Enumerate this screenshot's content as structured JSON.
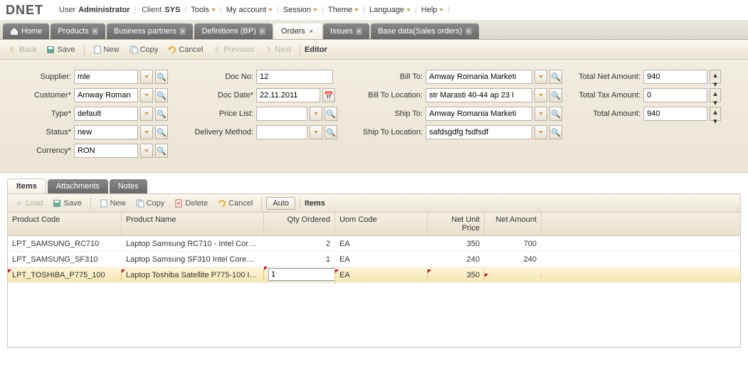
{
  "topmenu": {
    "logo": "DNET",
    "user_lbl": "User",
    "user_val": "Administrator",
    "client_lbl": "Client",
    "client_val": "SYS",
    "items": [
      "Tools",
      "My account",
      "Session",
      "Theme",
      "Language",
      "Help"
    ]
  },
  "tabs": [
    {
      "label": "Home",
      "icon": "home"
    },
    {
      "label": "Products",
      "close": true
    },
    {
      "label": "Business partners",
      "close": true
    },
    {
      "label": "Definitions (BP)",
      "close": true
    },
    {
      "label": "Orders",
      "close": true,
      "active": true
    },
    {
      "label": "Issues",
      "close": true
    },
    {
      "label": "Base data(Sales orders)",
      "close": true
    }
  ],
  "toolbar": {
    "back": "Back",
    "save": "Save",
    "new": "New",
    "copy": "Copy",
    "cancel": "Cancel",
    "prev": "Previous",
    "next": "Next",
    "editor": "Editor"
  },
  "form": {
    "supplier_lbl": "Supplier:",
    "supplier": "mle",
    "customer_lbl": "Customer*",
    "customer": "Amway Roman",
    "type_lbl": "Type*",
    "type": "default",
    "status_lbl": "Status*",
    "status": "new",
    "currency_lbl": "Currency*",
    "currency": "RON",
    "docno_lbl": "Doc No:",
    "docno": "12",
    "docdate_lbl": "Doc Date*",
    "docdate": "22.11.2011",
    "pricelist_lbl": "Price List:",
    "pricelist": "",
    "delivery_lbl": "Delivery Method:",
    "delivery": "",
    "billto_lbl": "Bill To:",
    "billto": "Amway Romania Marketi",
    "billloc_lbl": "Bill To Location:",
    "billloc": "str Marasti 40-44 ap 23 I",
    "shipto_lbl": "Ship To:",
    "shipto": "Amway Romania Marketi",
    "shiploc_lbl": "Ship To Location:",
    "shiploc": "safdsgdfg fsdfsdf",
    "totalnet_lbl": "Total Net Amount:",
    "totalnet": "940",
    "totaltax_lbl": "Total Tax Amount:",
    "totaltax": "0",
    "totalamt_lbl": "Total Amount:",
    "totalamt": "940"
  },
  "subtabs": [
    "Items",
    "Attachments",
    "Notes"
  ],
  "gridtoolbar": {
    "load": "Load",
    "save": "Save",
    "new": "New",
    "copy": "Copy",
    "delete": "Delete",
    "cancel": "Cancel",
    "auto": "Auto",
    "items": "Items"
  },
  "gridcols": [
    "Product Code",
    "Product Name",
    "Qty Ordered",
    "Uom Code",
    "Net Unit Price",
    "Net Amount"
  ],
  "gridrows": [
    {
      "code": "LPT_SAMSUNG_RC710",
      "name": "Laptop Samsung RC710 - Intel CoreT…",
      "qty": "2",
      "uom": "EA",
      "price": "350",
      "amt": "700"
    },
    {
      "code": "LPT_SAMSUNG_SF310",
      "name": "Laptop Samsung SF310 Intel CoreTM…",
      "qty": "1",
      "uom": "EA",
      "price": "240",
      "amt": "240"
    },
    {
      "code": "LPT_TOSHIBA_P775_100",
      "name": "Laptop Toshiba Satellite P775-100 In…",
      "qty": "1",
      "uom": "EA",
      "price": "350",
      "amt": "",
      "editing": true
    }
  ]
}
